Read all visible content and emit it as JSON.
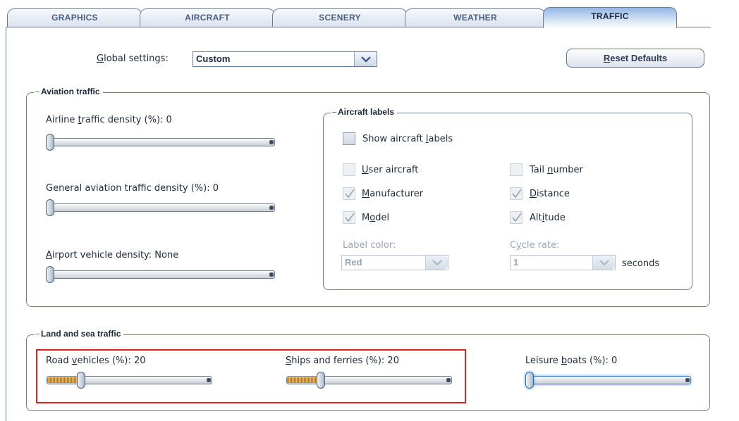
{
  "tabs": [
    {
      "label": "GRAPHICS"
    },
    {
      "label": "AIRCRAFT"
    },
    {
      "label": "SCENERY"
    },
    {
      "label": "WEATHER"
    },
    {
      "label": "TRAFFIC"
    }
  ],
  "global": {
    "label_pre": "",
    "label_u": "G",
    "label_post": "lobal settings:",
    "value": "Custom"
  },
  "reset": {
    "label_u": "R",
    "label_post": "eset Defaults"
  },
  "aviation": {
    "title": "Aviation traffic",
    "sliders": [
      {
        "pre": "Airline ",
        "u": "t",
        "post": "raffic density (%): 0",
        "value": 0
      },
      {
        "pre": "General aviation traf",
        "u": "f",
        "post": "ic density (%): 0",
        "value": 0
      },
      {
        "pre": "",
        "u": "A",
        "post": "irport vehicle density: None",
        "value": 0
      }
    ]
  },
  "labels": {
    "title": "Aircraft labels",
    "show": {
      "pre": "Show aircraft ",
      "u": "l",
      "post": "abels",
      "checked": false
    },
    "user_aircraft": {
      "pre": "",
      "u": "U",
      "post": "ser aircraft",
      "checked": false
    },
    "tail_number": {
      "pre": "Tail ",
      "u": "n",
      "post": "umber",
      "checked": false
    },
    "manufacturer": {
      "pre": "",
      "u": "M",
      "post": "anufacturer",
      "checked": true
    },
    "distance": {
      "pre": "",
      "u": "D",
      "post": "istance",
      "checked": true
    },
    "model": {
      "pre": "M",
      "u": "o",
      "post": "del",
      "checked": true
    },
    "altitude": {
      "pre": "Alt",
      "u": "i",
      "post": "tude",
      "checked": true
    },
    "label_color": {
      "label": "Label color:",
      "value": "Red"
    },
    "cycle_rate": {
      "pre": "C",
      "u": "y",
      "post": "cle rate:",
      "value": "1",
      "unit": "seconds"
    }
  },
  "land_sea": {
    "title": "Land and sea traffic",
    "sliders": [
      {
        "pre": "Road ",
        "u": "v",
        "post": "ehicles (%): 20",
        "value": 20
      },
      {
        "pre": "",
        "u": "S",
        "post": "hips and ferries (%): 20",
        "value": 20
      },
      {
        "pre": "Leisure ",
        "u": "b",
        "post": "oats (%): 0",
        "value": 0
      }
    ]
  },
  "colors": {
    "accent": "#6aa6ff",
    "highlight": "#e02020",
    "tab_active": "#93b5e3"
  }
}
